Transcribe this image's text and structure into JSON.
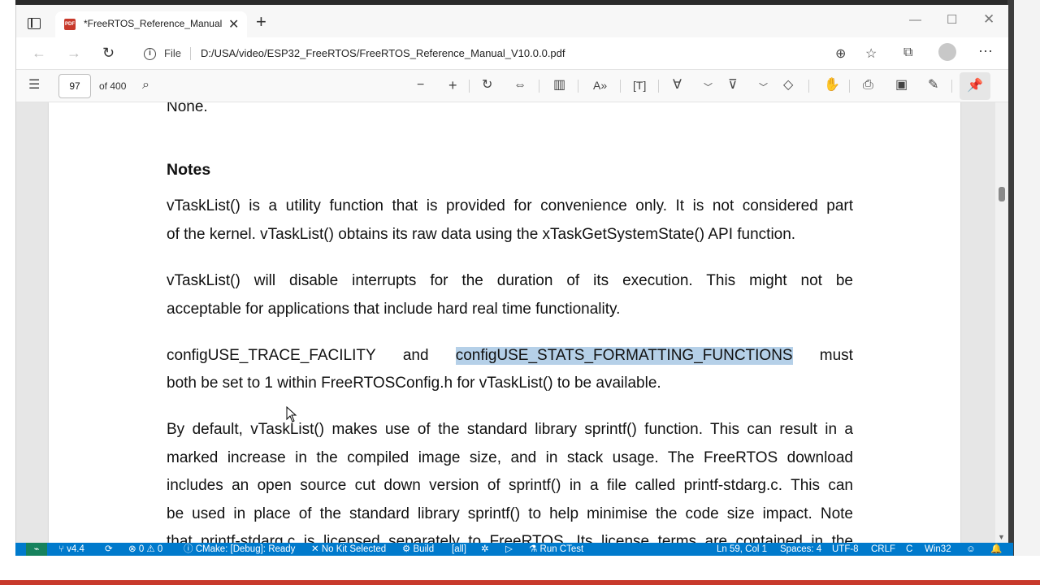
{
  "browser": {
    "tab_title": "*FreeRTOS_Reference_Manual_V",
    "address_file_label": "File",
    "url": "D:/USA/video/ESP32_FreeRTOS/FreeRTOS_Reference_Manual_V10.0.0.pdf"
  },
  "pdf_toolbar": {
    "page_number": "97",
    "page_count_label": "of 400"
  },
  "document": {
    "lines": {
      "l0": "None.",
      "notes_heading": "Notes",
      "p1a": "vTaskList() is a utility function that is provided for convenience only.  It is not considered part",
      "p1b": "of the kernel.  vTaskList() obtains its raw data using the xTaskGetSystemState() API function.",
      "p2a": "vTaskList() will disable interrupts for the duration of its execution.  This might not be",
      "p2b": "acceptable for applications that include hard real time functionality.",
      "p3a_1": "configUSE_TRACE_FACILITY",
      "p3a_2": "and",
      "p3a_highlight": "configUSE_STATS_FORMATTING_FUNCTIONS",
      "p3a_3": "must",
      "p3b": "both be set to 1 within FreeRTOSConfig.h for vTaskList() to be available.",
      "p4a": "By default, vTaskList() makes use of the standard library sprintf() function.  This can result in a",
      "p4b": "marked increase in the compiled image size, and in stack usage.  The FreeRTOS download",
      "p4c": "includes an open source cut down version of sprintf() in a file called printf-stdarg.c.  This can",
      "p4d": "be used in place of the standard library sprintf() to help minimise the code size impact.  Note",
      "p4e": "that printf-stdarg.c is licensed separately to FreeRTOS.  Its license terms are contained in the"
    },
    "highlight_color": "#b5d0e8"
  },
  "statusbar": {
    "remote": "⌁",
    "branch": "v4.4",
    "sync": "⟳",
    "problems": "⊗ 0 ⚠ 0",
    "cmake": "CMake: [Debug]: Ready",
    "kit": "No Kit Selected",
    "build": "Build",
    "target": "[all]",
    "debug_icon": "✲",
    "run": "▷",
    "ctest": "Run CTest",
    "position": "Ln 59, Col 1",
    "spaces": "Spaces: 4",
    "encoding": "UTF-8",
    "eol": "CRLF",
    "language": "C",
    "platform": "Win32",
    "color": "#007acc"
  }
}
